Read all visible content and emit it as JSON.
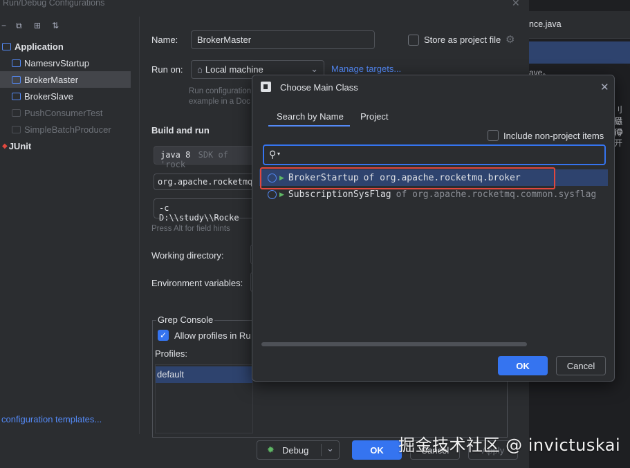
{
  "dialog": {
    "title": "Run/Debug Configurations",
    "close_glyph": "✕"
  },
  "toolbar": {
    "icons": [
      "minus-icon",
      "copy-icon",
      "new-folder-icon",
      "sort-icon"
    ],
    "glyphs": [
      "−",
      "⧉",
      "⊞",
      "⇅"
    ]
  },
  "tree": {
    "application_label": "Application",
    "items": [
      {
        "label": "NamesrvStartup",
        "dim": false
      },
      {
        "label": "BrokerMaster",
        "dim": false,
        "selected": true
      },
      {
        "label": "BrokerSlave",
        "dim": false
      },
      {
        "label": "PushConsumerTest",
        "dim": true
      },
      {
        "label": "SimpleBatchProducer",
        "dim": true
      }
    ],
    "junit_label": "JUnit",
    "edit_templates": "configuration templates..."
  },
  "config": {
    "name_label": "Name:",
    "name_value": "BrokerMaster",
    "store_label": "Store as project file",
    "runon_label": "Run on:",
    "runon_value": "Local machine",
    "manage_targets": "Manage targets...",
    "runon_hint_1": "Run configuration",
    "runon_hint_2": "example in a Doc",
    "build_run_title": "Build and run",
    "sdk_value": "java 8",
    "sdk_hint": "SDK of 'rock",
    "main_class_value": "org.apache.rocketmq.",
    "args_value": "-c D:\\\\study\\\\Rocke",
    "field_hints": "Press Alt for field hints",
    "working_dir_label": "Working directory:",
    "env_vars_label": "Environment variables:",
    "grep_console_title": "Grep Console",
    "allow_profiles_label": "Allow profiles in Ru",
    "profiles_label": "Profiles:",
    "profile_default": "default"
  },
  "bottom": {
    "debug_label": "Debug",
    "ok_label": "OK",
    "cancel_label": "Cancel",
    "apply_label": "Apply"
  },
  "popup": {
    "title": "Choose Main Class",
    "close_glyph": "✕",
    "tab_search": "Search by Name",
    "tab_project": "Project",
    "include_label": "Include non-project items",
    "search_value": "",
    "results": [
      {
        "name": "BrokerStartup",
        "of": "of org.apache.rocketmq.broker",
        "selected": true
      },
      {
        "name": "SubscriptionSysFlag",
        "of": "of org.apache.rocketmq.common.sysflag",
        "selected": false
      }
    ],
    "ok_label": "OK",
    "cancel_label": "Cancel"
  },
  "editor_bg": {
    "tab_label": "nce.java",
    "code_lines": [
      "ave。",
      "刂磁",
      "尽得",
      "IO开"
    ]
  },
  "watermark": "掘金技术社区 @ invictuskai",
  "colors": {
    "accent": "#3574f0",
    "selection": "#2e436e",
    "highlight_red": "#e2483e",
    "link": "#548af7"
  }
}
